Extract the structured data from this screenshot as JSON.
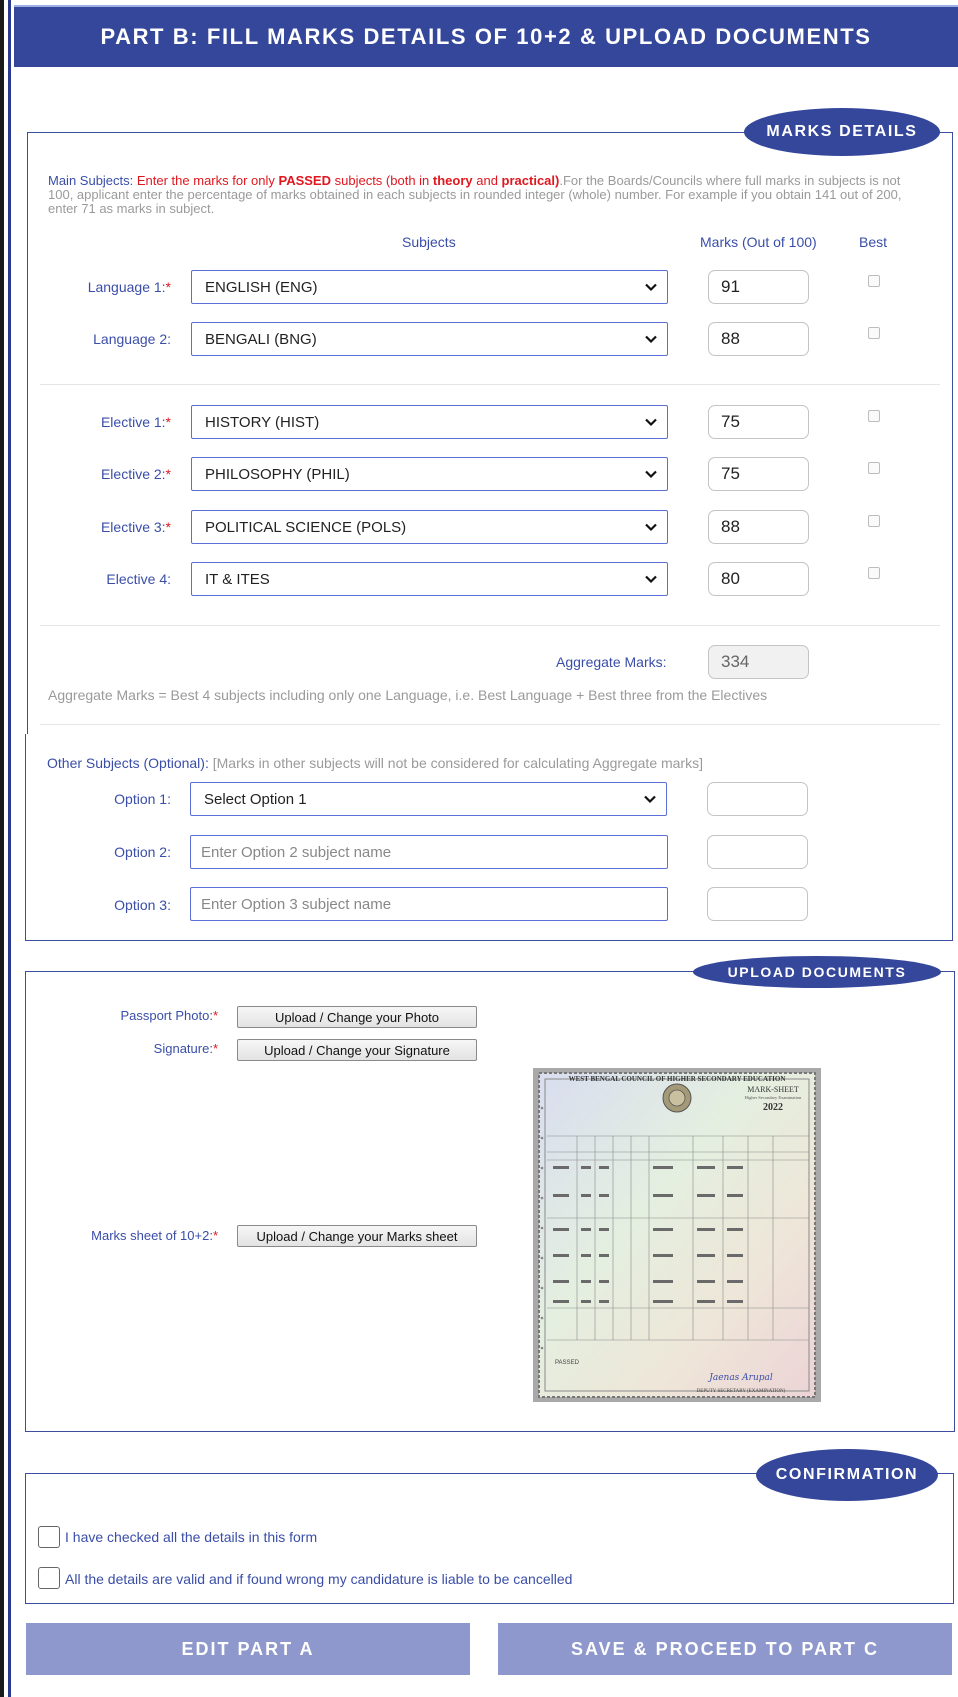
{
  "header": {
    "title": "PART B: FILL MARKS DETAILS OF 10+2 & UPLOAD DOCUMENTS"
  },
  "marks": {
    "badge": "MARKS DETAILS",
    "note": {
      "p1": "Main Subjects: ",
      "p2": "Enter the marks for only ",
      "p3": "PASSED",
      "p4": " subjects (both in ",
      "p5": "theory",
      "p6": " and ",
      "p7": "practical)",
      "p8": ".For the Boards/Councils where full marks in subjects is not 100, applicant enter the percentage of marks obtained in each subjects in rounded integer (whole) number. For example if you obtain 141 out of 200, enter 71 as marks in subject."
    },
    "col_subjects": "Subjects",
    "col_marks": "Marks (Out of 100)",
    "col_best": "Best",
    "rows": [
      {
        "label": "Language 1:",
        "star": "*",
        "subject": "ENGLISH (ENG)",
        "marks": "91"
      },
      {
        "label": "Language 2:",
        "star": "",
        "subject": "BENGALI (BNG)",
        "marks": "88"
      },
      {
        "label": "Elective 1:",
        "star": "*",
        "subject": "HISTORY (HIST)",
        "marks": "75"
      },
      {
        "label": "Elective 2:",
        "star": "*",
        "subject": "PHILOSOPHY (PHIL)",
        "marks": "75"
      },
      {
        "label": "Elective 3:",
        "star": "*",
        "subject": "POLITICAL SCIENCE (POLS)",
        "marks": "88"
      },
      {
        "label": "Elective 4:",
        "star": "",
        "subject": "IT & ITES",
        "marks": "80"
      }
    ],
    "aggregate_label": "Aggregate Marks:",
    "aggregate_value": "334",
    "aggregate_note": "Aggregate Marks = Best 4 subjects including only one Language, i.e. Best Language + Best three from the Electives"
  },
  "other": {
    "note_title": "Other Subjects (Optional):",
    "note_text": " [Marks in other subjects will not be considered for calculating Aggregate marks]",
    "options": [
      {
        "label": "Option 1:",
        "value": "Select Option 1"
      },
      {
        "label": "Option 2:",
        "placeholder": "Enter Option 2 subject name"
      },
      {
        "label": "Option 3:",
        "placeholder": "Enter Option 3 subject name"
      }
    ]
  },
  "upload": {
    "badge": "UPLOAD DOCUMENTS",
    "photo_label": "Passport Photo:",
    "photo_button": "Upload / Change your Photo",
    "signature_label": "Signature:",
    "signature_button": "Upload / Change your Signature",
    "marksheet_label": "Marks sheet of 10+2:",
    "marksheet_button": "Upload / Change your Marks sheet",
    "star": "*",
    "preview": {
      "council": "WEST BENGAL COUNCIL OF HIGHER SECONDARY EDUCATION",
      "doc_title": "MARK-SHEET",
      "subtitle": "Higher Secondary Examination",
      "year": "2022",
      "result": "PASSED",
      "signature_text": "Jaenas Arupal",
      "signatory": "DEPUTY SECRETARY (EXAMINATION)"
    }
  },
  "confirm": {
    "badge": "CONFIRMATION",
    "item1": "I have checked all the details in this form",
    "item2": "All the details are valid and if found wrong my candidature is liable to be cancelled"
  },
  "buttons": {
    "edit": "EDIT PART A",
    "save": "SAVE & PROCEED TO PART C"
  },
  "colors": {
    "primary": "#35479a",
    "button": "#8e98cc",
    "required": "#e0171f",
    "label": "#3a4ea8"
  }
}
